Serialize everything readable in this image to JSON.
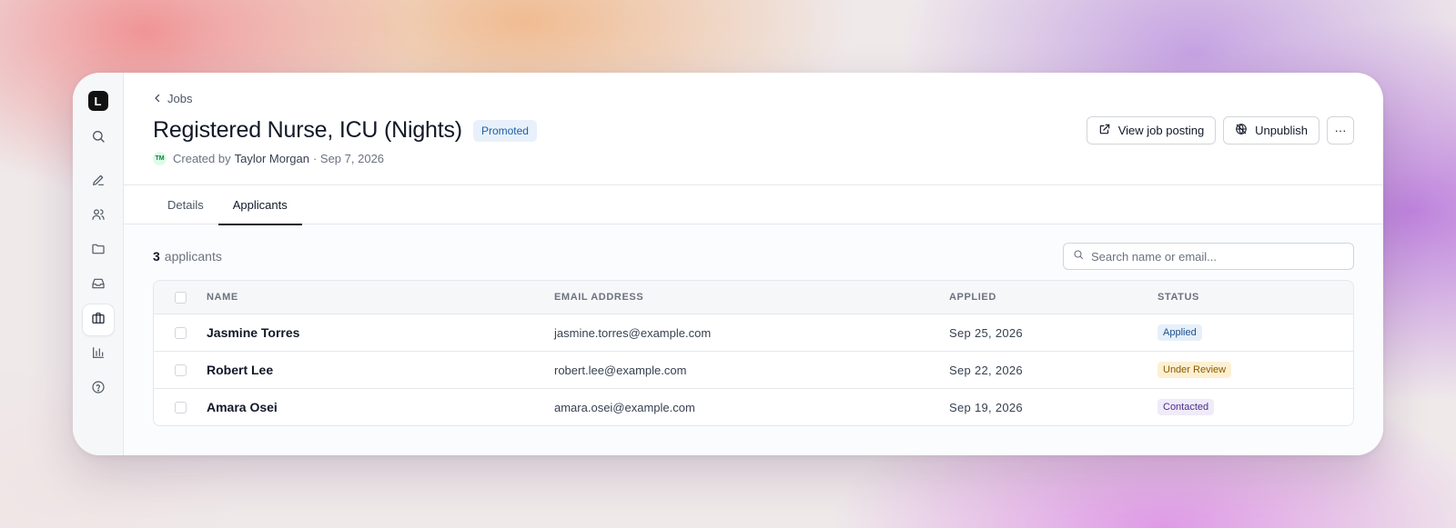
{
  "app": {
    "logo_letter": "L"
  },
  "sidebar": {
    "items": [
      {
        "name": "search",
        "icon": "search-icon",
        "active": false
      },
      {
        "name": "compose",
        "icon": "pencil-icon",
        "active": false
      },
      {
        "name": "people",
        "icon": "users-icon",
        "active": false
      },
      {
        "name": "files",
        "icon": "folder-icon",
        "active": false
      },
      {
        "name": "inbox",
        "icon": "inbox-icon",
        "active": false
      },
      {
        "name": "jobs",
        "icon": "briefcase-icon",
        "active": true
      },
      {
        "name": "reports",
        "icon": "bar-chart-icon",
        "active": false
      },
      {
        "name": "help",
        "icon": "help-circle-icon",
        "active": false
      }
    ]
  },
  "header": {
    "back_label": "Jobs",
    "title": "Registered Nurse, ICU (Nights)",
    "badge": "Promoted",
    "meta": {
      "avatar_initials": "TM",
      "created_by_label": "Created by",
      "author": "Taylor Morgan",
      "date": "· Sep 7, 2026"
    },
    "actions": {
      "view_posting": "View job posting",
      "unpublish": "Unpublish",
      "more": "···"
    }
  },
  "tabs": [
    {
      "label": "Details",
      "active": false
    },
    {
      "label": "Applicants",
      "active": true
    }
  ],
  "applicants": {
    "count": "3",
    "count_label": "applicants",
    "search_placeholder": "Search name or email...",
    "columns": {
      "name": "NAME",
      "email": "EMAIL ADDRESS",
      "applied": "APPLIED",
      "status": "STATUS"
    },
    "rows": [
      {
        "name": "Jasmine Torres",
        "email": "jasmine.torres@example.com",
        "applied": "Sep 25, 2026",
        "status": "Applied"
      },
      {
        "name": "Robert Lee",
        "email": "robert.lee@example.com",
        "applied": "Sep 22, 2026",
        "status": "Under Review"
      },
      {
        "name": "Amara Osei",
        "email": "amara.osei@example.com",
        "applied": "Sep 19, 2026",
        "status": "Contacted"
      }
    ]
  },
  "colors": {
    "status_applied_bg": "#e6f0fa",
    "status_applied_fg": "#1e4e8c",
    "status_review_bg": "#fdf0d2",
    "status_review_fg": "#8a5a00",
    "status_contacted_bg": "#efebf8",
    "status_contacted_fg": "#4c2e8a",
    "accent": "#111827"
  }
}
